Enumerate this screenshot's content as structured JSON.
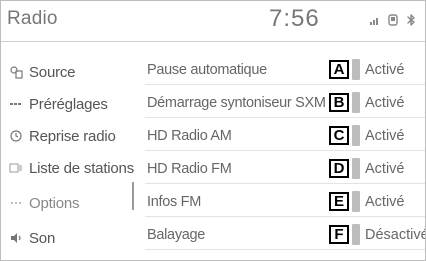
{
  "header": {
    "title": "Radio",
    "time": "7:56",
    "status_icons": [
      "signal-icon",
      "phone-icon",
      "bluetooth-icon"
    ]
  },
  "sidebar": {
    "items": [
      {
        "label": "Source",
        "icon": "source-icon"
      },
      {
        "label": "Préréglages",
        "icon": "presets-icon"
      },
      {
        "label": "Reprise radio",
        "icon": "resume-icon"
      },
      {
        "label": "Liste de stations",
        "icon": "station-list-icon"
      },
      {
        "label": "Options",
        "icon": "options-icon",
        "active": true
      },
      {
        "label": "Son",
        "icon": "sound-icon"
      }
    ]
  },
  "options": {
    "rows": [
      {
        "label": "Pause automatique",
        "marker": "A",
        "state": "Activé"
      },
      {
        "label": "Démarrage syntoniseur SXM",
        "marker": "B",
        "state": "Activé"
      },
      {
        "label": "HD Radio AM",
        "marker": "C",
        "state": "Activé"
      },
      {
        "label": "HD Radio FM",
        "marker": "D",
        "state": "Activé"
      },
      {
        "label": "Infos FM",
        "marker": "E",
        "state": "Activé"
      },
      {
        "label": "Balayage",
        "marker": "F",
        "state": "Désactivé"
      }
    ]
  },
  "colors": {
    "frame_border": "#bdbdbd",
    "text_gray": "#666666",
    "toggle_gray": "#bdbdbd",
    "marker_border": "#000000"
  }
}
